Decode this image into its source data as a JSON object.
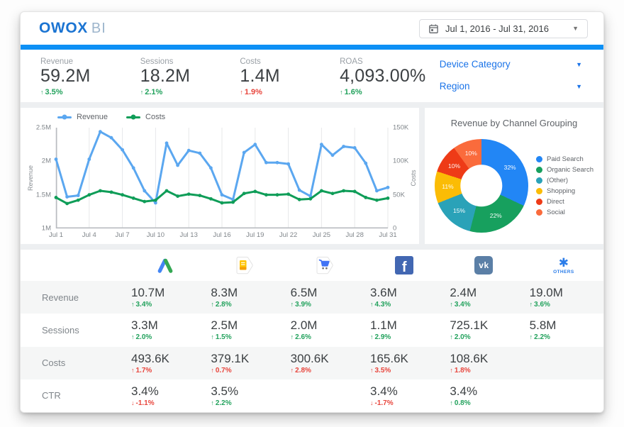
{
  "header": {
    "logo_primary": "OWOX",
    "logo_secondary": "BI",
    "date_range": "Jul 1, 2016 - Jul 31, 2016"
  },
  "colors": {
    "top_bar": "#0D90F5",
    "logo_blue": "#1B74D2",
    "link_blue": "#1A73E8",
    "positive": "#23A25D",
    "negative": "#E8453C"
  },
  "kpis": [
    {
      "label": "Revenue",
      "value": "59.2M",
      "delta": "3.5%",
      "direction": "up",
      "trend": "positive"
    },
    {
      "label": "Sessions",
      "value": "18.2M",
      "delta": "2.1%",
      "direction": "up",
      "trend": "positive"
    },
    {
      "label": "Costs",
      "value": "1.4M",
      "delta": "1.9%",
      "direction": "up",
      "trend": "negative"
    },
    {
      "label": "ROAS",
      "value": "4,093.00%",
      "delta": "1.6%",
      "direction": "up",
      "trend": "positive"
    }
  ],
  "filters": [
    {
      "label": "Device Category"
    },
    {
      "label": "Region"
    }
  ],
  "chart_data": [
    {
      "type": "line",
      "x": [
        "Jul 1",
        "Jul 2",
        "Jul 3",
        "Jul 4",
        "Jul 5",
        "Jul 6",
        "Jul 7",
        "Jul 8",
        "Jul 9",
        "Jul 10",
        "Jul 11",
        "Jul 12",
        "Jul 13",
        "Jul 14",
        "Jul 15",
        "Jul 16",
        "Jul 17",
        "Jul 18",
        "Jul 19",
        "Jul 20",
        "Jul 21",
        "Jul 22",
        "Jul 23",
        "Jul 24",
        "Jul 25",
        "Jul 26",
        "Jul 27",
        "Jul 28",
        "Jul 29",
        "Jul 30",
        "Jul 31"
      ],
      "x_tick_labels": [
        "Jul 1",
        "Jul 4",
        "Jul 7",
        "Jul 10",
        "Jul 13",
        "Jul 16",
        "Jul 19",
        "Jul 22",
        "Jul 25",
        "Jul 28",
        "Jul 31"
      ],
      "left_axis": {
        "label": "Revenue",
        "min": 1,
        "max": 2.5,
        "unit": "M",
        "ticks": [
          {
            "label": "2.5M",
            "value": 2.5
          },
          {
            "label": "2M",
            "value": 2
          },
          {
            "label": "1.5M",
            "value": 1.5
          },
          {
            "label": "1M",
            "value": 1
          }
        ]
      },
      "right_axis": {
        "label": "Costs",
        "min": 0,
        "max": 150,
        "unit": "K",
        "ticks": [
          {
            "label": "150K",
            "value": 150
          },
          {
            "label": "100K",
            "value": 100
          },
          {
            "label": "50K",
            "value": 50
          },
          {
            "label": "0",
            "value": 0
          }
        ]
      },
      "series": [
        {
          "name": "Revenue",
          "axis": "left",
          "color": "#5BA7F0",
          "values": [
            2.03,
            1.47,
            1.49,
            2.03,
            2.44,
            2.35,
            2.17,
            1.9,
            1.56,
            1.38,
            2.27,
            1.94,
            2.16,
            2.12,
            1.9,
            1.5,
            1.43,
            2.13,
            2.25,
            1.98,
            1.98,
            1.96,
            1.57,
            1.48,
            2.25,
            2.09,
            2.22,
            2.2,
            1.97,
            1.56,
            1.61
          ]
        },
        {
          "name": "Costs",
          "axis": "right",
          "color": "#0F9D58",
          "values": [
            46,
            37,
            42,
            50,
            56,
            54,
            50,
            45,
            40,
            42,
            56,
            48,
            51,
            49,
            44,
            38,
            39,
            52,
            55,
            50,
            50,
            51,
            43,
            44,
            56,
            52,
            56,
            55,
            46,
            42,
            45
          ]
        }
      ],
      "grid": "vertical"
    },
    {
      "type": "pie",
      "donut": true,
      "title": "Revenue by Channel Grouping",
      "legend_position": "right",
      "slices": [
        {
          "label": "Paid Search",
          "value_pct": 32,
          "color": "#2286F5"
        },
        {
          "label": "Organic Search",
          "value_pct": 22,
          "color": "#17A05E"
        },
        {
          "label": "(Other)",
          "value_pct": 15,
          "color": "#2AA2B8"
        },
        {
          "label": "Shopping",
          "value_pct": 11,
          "color": "#FBBC05"
        },
        {
          "label": "Direct",
          "value_pct": 10,
          "color": "#EE3B17"
        },
        {
          "label": "Social",
          "value_pct": 10,
          "color": "#FA6B3C"
        }
      ]
    }
  ],
  "table": {
    "columns": [
      {
        "icon": "google-ads-icon"
      },
      {
        "icon": "yandex-market-icon"
      },
      {
        "icon": "google-shopping-icon"
      },
      {
        "icon": "facebook-icon"
      },
      {
        "icon": "vk-icon"
      },
      {
        "icon": "others-icon",
        "caption": "OTHERS"
      }
    ],
    "rows": [
      {
        "label": "Revenue",
        "cells": [
          {
            "value": "10.7M",
            "delta": "3.4%",
            "direction": "up",
            "trend": "positive"
          },
          {
            "value": "8.3M",
            "delta": "2.8%",
            "direction": "up",
            "trend": "positive"
          },
          {
            "value": "6.5M",
            "delta": "3.9%",
            "direction": "up",
            "trend": "positive"
          },
          {
            "value": "3.6M",
            "delta": "4.3%",
            "direction": "up",
            "trend": "positive"
          },
          {
            "value": "2.4M",
            "delta": "3.4%",
            "direction": "up",
            "trend": "positive"
          },
          {
            "value": "19.0M",
            "delta": "3.6%",
            "direction": "up",
            "trend": "positive"
          }
        ]
      },
      {
        "label": "Sessions",
        "cells": [
          {
            "value": "3.3M",
            "delta": "2.0%",
            "direction": "up",
            "trend": "positive"
          },
          {
            "value": "2.5M",
            "delta": "1.5%",
            "direction": "up",
            "trend": "positive"
          },
          {
            "value": "2.0M",
            "delta": "2.6%",
            "direction": "up",
            "trend": "positive"
          },
          {
            "value": "1.1M",
            "delta": "2.9%",
            "direction": "up",
            "trend": "positive"
          },
          {
            "value": "725.1K",
            "delta": "2.0%",
            "direction": "up",
            "trend": "positive"
          },
          {
            "value": "5.8M",
            "delta": "2.2%",
            "direction": "up",
            "trend": "positive"
          }
        ]
      },
      {
        "label": "Costs",
        "cells": [
          {
            "value": "493.6K",
            "delta": "1.7%",
            "direction": "up",
            "trend": "negative"
          },
          {
            "value": "379.1K",
            "delta": "0.7%",
            "direction": "up",
            "trend": "negative"
          },
          {
            "value": "300.6K",
            "delta": "2.8%",
            "direction": "up",
            "trend": "negative"
          },
          {
            "value": "165.6K",
            "delta": "3.5%",
            "direction": "up",
            "trend": "negative"
          },
          {
            "value": "108.6K",
            "delta": "1.8%",
            "direction": "up",
            "trend": "negative"
          },
          null
        ]
      },
      {
        "label": "CTR",
        "cells": [
          {
            "value": "3.4%",
            "delta": "-1.1%",
            "direction": "down",
            "trend": "negative"
          },
          {
            "value": "3.5%",
            "delta": "2.2%",
            "direction": "up",
            "trend": "positive"
          },
          null,
          {
            "value": "3.4%",
            "delta": "-1.7%",
            "direction": "down",
            "trend": "negative"
          },
          {
            "value": "3.4%",
            "delta": "0.8%",
            "direction": "up",
            "trend": "positive"
          },
          null
        ]
      }
    ]
  }
}
